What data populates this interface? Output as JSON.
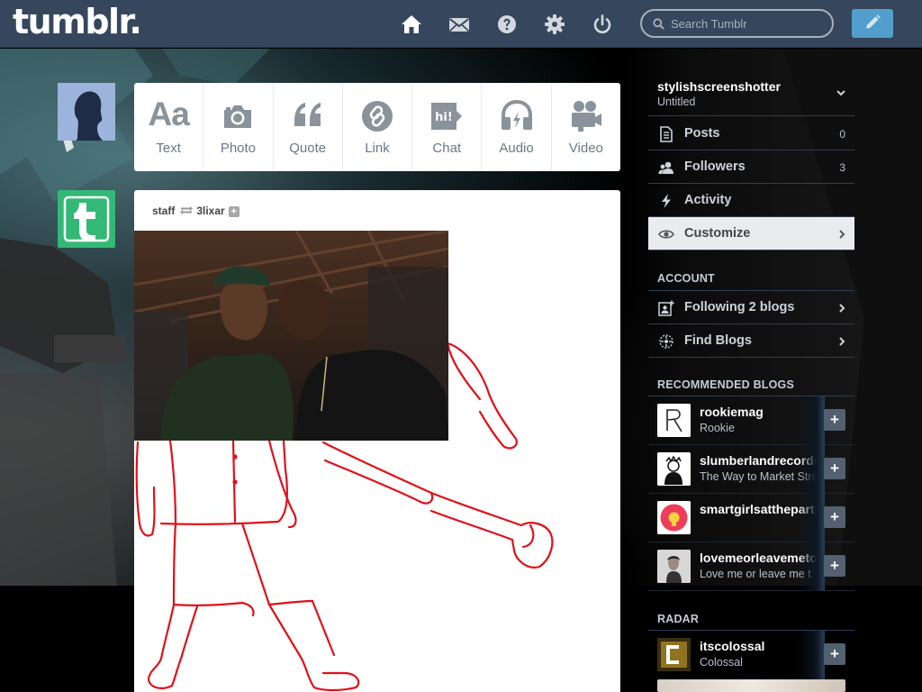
{
  "header": {
    "logo": "tumblr.",
    "nav": [
      "home-icon",
      "envelope-icon",
      "help-icon",
      "gear-icon",
      "power-icon"
    ],
    "search_placeholder": "Search Tumblr",
    "compose_icon": "pencil-icon"
  },
  "post_types": [
    {
      "label": "Text",
      "icon": "text-aa-icon"
    },
    {
      "label": "Photo",
      "icon": "camera-icon"
    },
    {
      "label": "Quote",
      "icon": "quote-icon"
    },
    {
      "label": "Link",
      "icon": "link-icon"
    },
    {
      "label": "Chat",
      "icon": "chat-icon",
      "glyph": "hi!"
    },
    {
      "label": "Audio",
      "icon": "headphones-icon"
    },
    {
      "label": "Video",
      "icon": "video-camera-icon"
    }
  ],
  "text_glyph": "Aa",
  "post": {
    "author": "staff",
    "reblogged_from": "3lixar",
    "follow_symbol": "+"
  },
  "sidebar": {
    "blog_name": "stylishscreenshotter",
    "blog_subtitle": "Untitled",
    "items": [
      {
        "label": "Posts",
        "count": "0",
        "icon": "posts-icon"
      },
      {
        "label": "Followers",
        "count": "3",
        "icon": "followers-icon"
      },
      {
        "label": "Activity",
        "icon": "lightning-icon"
      },
      {
        "label": "Customize",
        "icon": "eye-icon",
        "active": true
      }
    ],
    "account_heading": "ACCOUNT",
    "account_items": [
      {
        "label": "Following 2 blogs",
        "icon": "following-icon"
      },
      {
        "label": "Find Blogs",
        "icon": "find-blogs-icon"
      }
    ],
    "recommended_heading": "RECOMMENDED BLOGS",
    "recommended": [
      {
        "name": "rookiemag",
        "desc": "Rookie"
      },
      {
        "name": "slumberlandrecords",
        "desc": "The Way to Market Street"
      },
      {
        "name": "smartgirlsattheparty",
        "desc": ""
      },
      {
        "name": "lovemeorleavemetoo",
        "desc": "Love me or leave me t"
      }
    ],
    "radar_heading": "RADAR",
    "radar": {
      "name": "itscolossal",
      "desc": "Colossal"
    }
  },
  "colors": {
    "header_bg": "#36465d",
    "compose_bg": "#529ecc",
    "staff_avatar": "#34b876",
    "drawing_stroke": "#e0101a"
  }
}
